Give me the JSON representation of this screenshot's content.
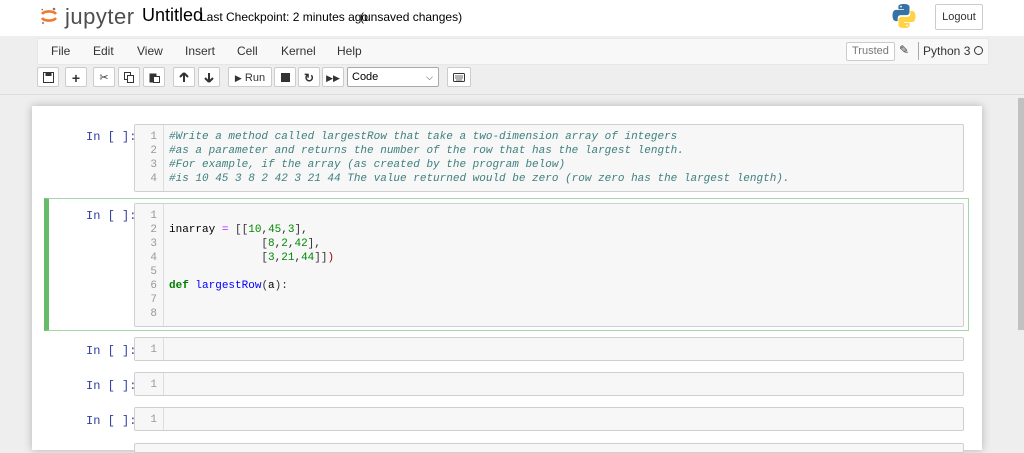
{
  "header": {
    "logo_text": "jupyter",
    "notebook_name": "Untitled",
    "checkpoint": "Last Checkpoint: 2 minutes ago",
    "unsaved": "(unsaved changes)",
    "logout_label": "Logout"
  },
  "menubar": {
    "items": [
      "File",
      "Edit",
      "View",
      "Insert",
      "Cell",
      "Kernel",
      "Help"
    ],
    "trusted_label": "Trusted",
    "kernel_name": "Python 3"
  },
  "toolbar": {
    "run_label": "Run",
    "cell_type": "Code"
  },
  "cells": [
    {
      "prompt": "In [ ]:",
      "lines": [
        {
          "n": "1",
          "text": "#Write a method called largestRow that take a two-dimension array of integers"
        },
        {
          "n": "2",
          "text": "#as a parameter and returns the number of the row that has the largest length."
        },
        {
          "n": "3",
          "text": "#For example, if the array (as created by the program below)"
        },
        {
          "n": "4",
          "text": "#is 10 45 3 8 2 42 3 21 44 The value returned would be zero (row zero has the largest length)."
        }
      ]
    },
    {
      "prompt": "In [ ]:",
      "lines": [
        {
          "n": "1",
          "text": ""
        },
        {
          "n": "2",
          "text": "inarray = [[10,45,3],"
        },
        {
          "n": "3",
          "text": "              [8,2,42],"
        },
        {
          "n": "4",
          "text": "              [3,21,44]])"
        },
        {
          "n": "5",
          "text": ""
        },
        {
          "n": "6",
          "text": "def largestRow(a):"
        },
        {
          "n": "7",
          "text": ""
        },
        {
          "n": "8",
          "text": ""
        }
      ]
    },
    {
      "prompt": "In [ ]:",
      "lines": [
        {
          "n": "1",
          "text": ""
        }
      ]
    },
    {
      "prompt": "In [ ]:",
      "lines": [
        {
          "n": "1",
          "text": ""
        }
      ]
    },
    {
      "prompt": "In [ ]:",
      "lines": [
        {
          "n": "1",
          "text": ""
        }
      ]
    }
  ]
}
